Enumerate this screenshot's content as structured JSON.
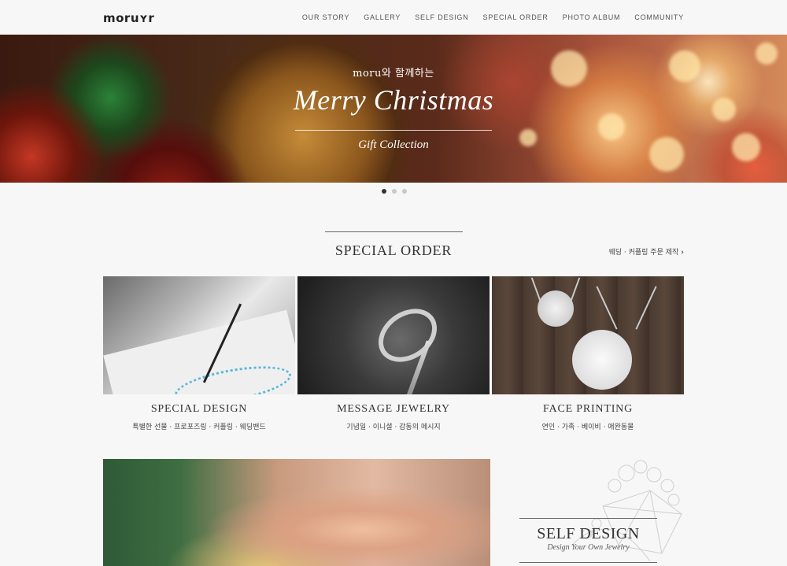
{
  "header": {
    "logo": "moruʏr",
    "nav": [
      "OUR STORY",
      "GALLERY",
      "SELF DESIGN",
      "SPECIAL ORDER",
      "PHOTO ALBUM",
      "COMMUNITY"
    ]
  },
  "hero": {
    "subtitle": "moru와 함께하는",
    "title": "Merry Christmas",
    "caption": "Gift Collection",
    "slides": 3,
    "active_slide": 1
  },
  "special_order": {
    "title": "SPECIAL ORDER",
    "link": "웨딩 · 커플링 주문 제작",
    "cards": [
      {
        "title": "SPECIAL DESIGN",
        "desc": "특별한 선물 · 프로포즈링 · 커플링 · 웨딩밴드"
      },
      {
        "title": "MESSAGE JEWELRY",
        "desc": "기념일 · 이니셜 · 감동의 메시지"
      },
      {
        "title": "FACE PRINTING",
        "desc": "연인 · 가족 · 베이비 · 애완동물"
      }
    ]
  },
  "self_design": {
    "title": "SELF DESIGN",
    "subtitle": "Design Your Own Jewelry"
  },
  "colors": {
    "background": "#f7f7f7",
    "text": "#333333",
    "accent_line": "#666666"
  }
}
